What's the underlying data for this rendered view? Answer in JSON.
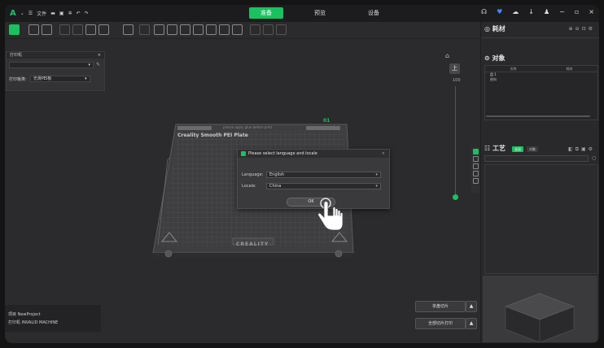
{
  "titlebar": {
    "logo": "A",
    "menu_label": "文件",
    "tabs": [
      {
        "label": "准备",
        "active": true
      },
      {
        "label": "预览",
        "active": false
      },
      {
        "label": "设备",
        "active": false
      }
    ],
    "window_controls": [
      "−",
      "▫",
      "×"
    ]
  },
  "printer_panel": {
    "title": "打印机",
    "close": "×",
    "printer_value": "",
    "plate_label": "打印板类:",
    "plate_value": "光滑PEI板"
  },
  "bed": {
    "plate_name": "Creality Smooth PEI Plate",
    "top_text": "please apply glue before print",
    "plate_number": "01",
    "brand": "CREALITY"
  },
  "dialog": {
    "title": "Please select language and locale",
    "close": "×",
    "language_label": "Language:",
    "language_value": "English",
    "locale_label": "Locale:",
    "locale_value": "China",
    "ok_label": "OK"
  },
  "view_controls": {
    "top_label": "上",
    "zoom_text": "100"
  },
  "bottom_info": {
    "project": "项目 NewProject",
    "printer": "打印机 INVALID MACHINE"
  },
  "slice_buttons": {
    "slice_single": "单盘切片",
    "slice_all": "全部切片打印",
    "arrow": "▲"
  },
  "right_panel": {
    "filament_title": "耗材",
    "objects_title": "对象",
    "object_columns": [
      "名称",
      "耗材"
    ],
    "object_items": [
      "盘 1",
      "逆向"
    ],
    "process_title": "工艺",
    "process_tabs": [
      "全局",
      "对象"
    ]
  },
  "colors": {
    "accent": "#19c25f",
    "background": "#2b2b2d",
    "titlebar": "#1c1c1e"
  }
}
